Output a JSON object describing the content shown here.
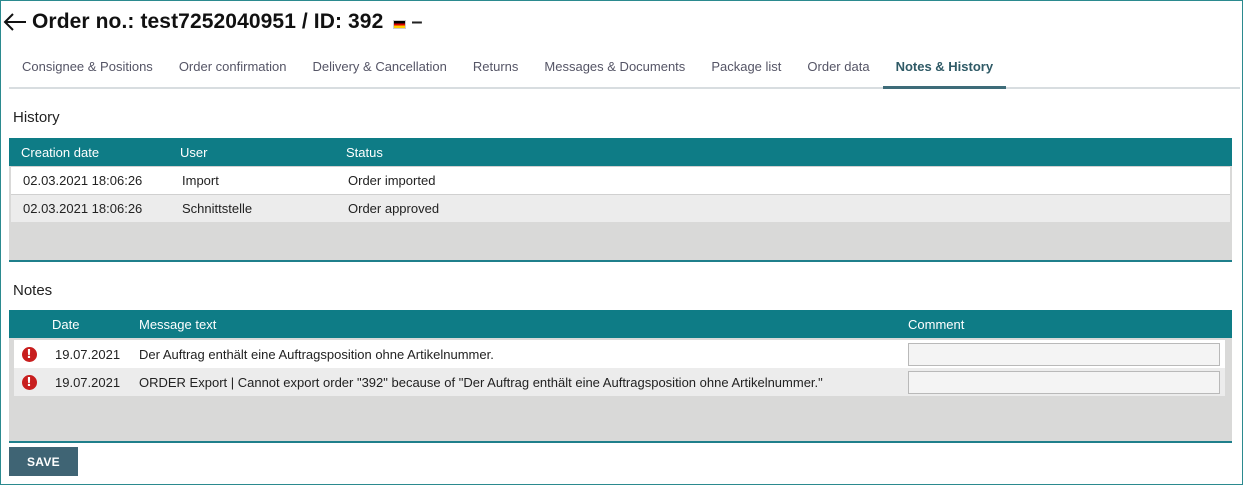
{
  "header": {
    "title": "Order no.: test7252040951 / ID: 392",
    "dash": "–"
  },
  "tabs": [
    {
      "label": "Consignee & Positions"
    },
    {
      "label": "Order confirmation"
    },
    {
      "label": "Delivery & Cancellation"
    },
    {
      "label": "Returns"
    },
    {
      "label": "Messages & Documents"
    },
    {
      "label": "Package list"
    },
    {
      "label": "Order data"
    },
    {
      "label": "Notes & History",
      "active": true
    }
  ],
  "history": {
    "title": "History",
    "columns": [
      "Creation date",
      "User",
      "Status"
    ],
    "rows": [
      {
        "date": "02.03.2021 18:06:26",
        "user": "Import",
        "status": "Order imported"
      },
      {
        "date": "02.03.2021 18:06:26",
        "user": "Schnittstelle",
        "status": "Order approved"
      }
    ]
  },
  "notes": {
    "title": "Notes",
    "columns": [
      "",
      "Date",
      "Message text",
      "Comment"
    ],
    "rows": [
      {
        "icon": "warning-icon",
        "date": "19.07.2021",
        "message": "Der Auftrag enthält eine Auftragsposition ohne Artikelnummer.",
        "comment": ""
      },
      {
        "icon": "warning-icon",
        "date": "19.07.2021",
        "message": "ORDER Export | Cannot export order \"392\" because of \"Der Auftrag enthält eine Auftragsposition ohne Artikelnummer.\"",
        "comment": ""
      }
    ]
  },
  "actions": {
    "save_label": "SAVE"
  },
  "colors": {
    "grid_header": "#0e7c86",
    "save_button": "#3f6474",
    "warning": "#c81e1e"
  }
}
